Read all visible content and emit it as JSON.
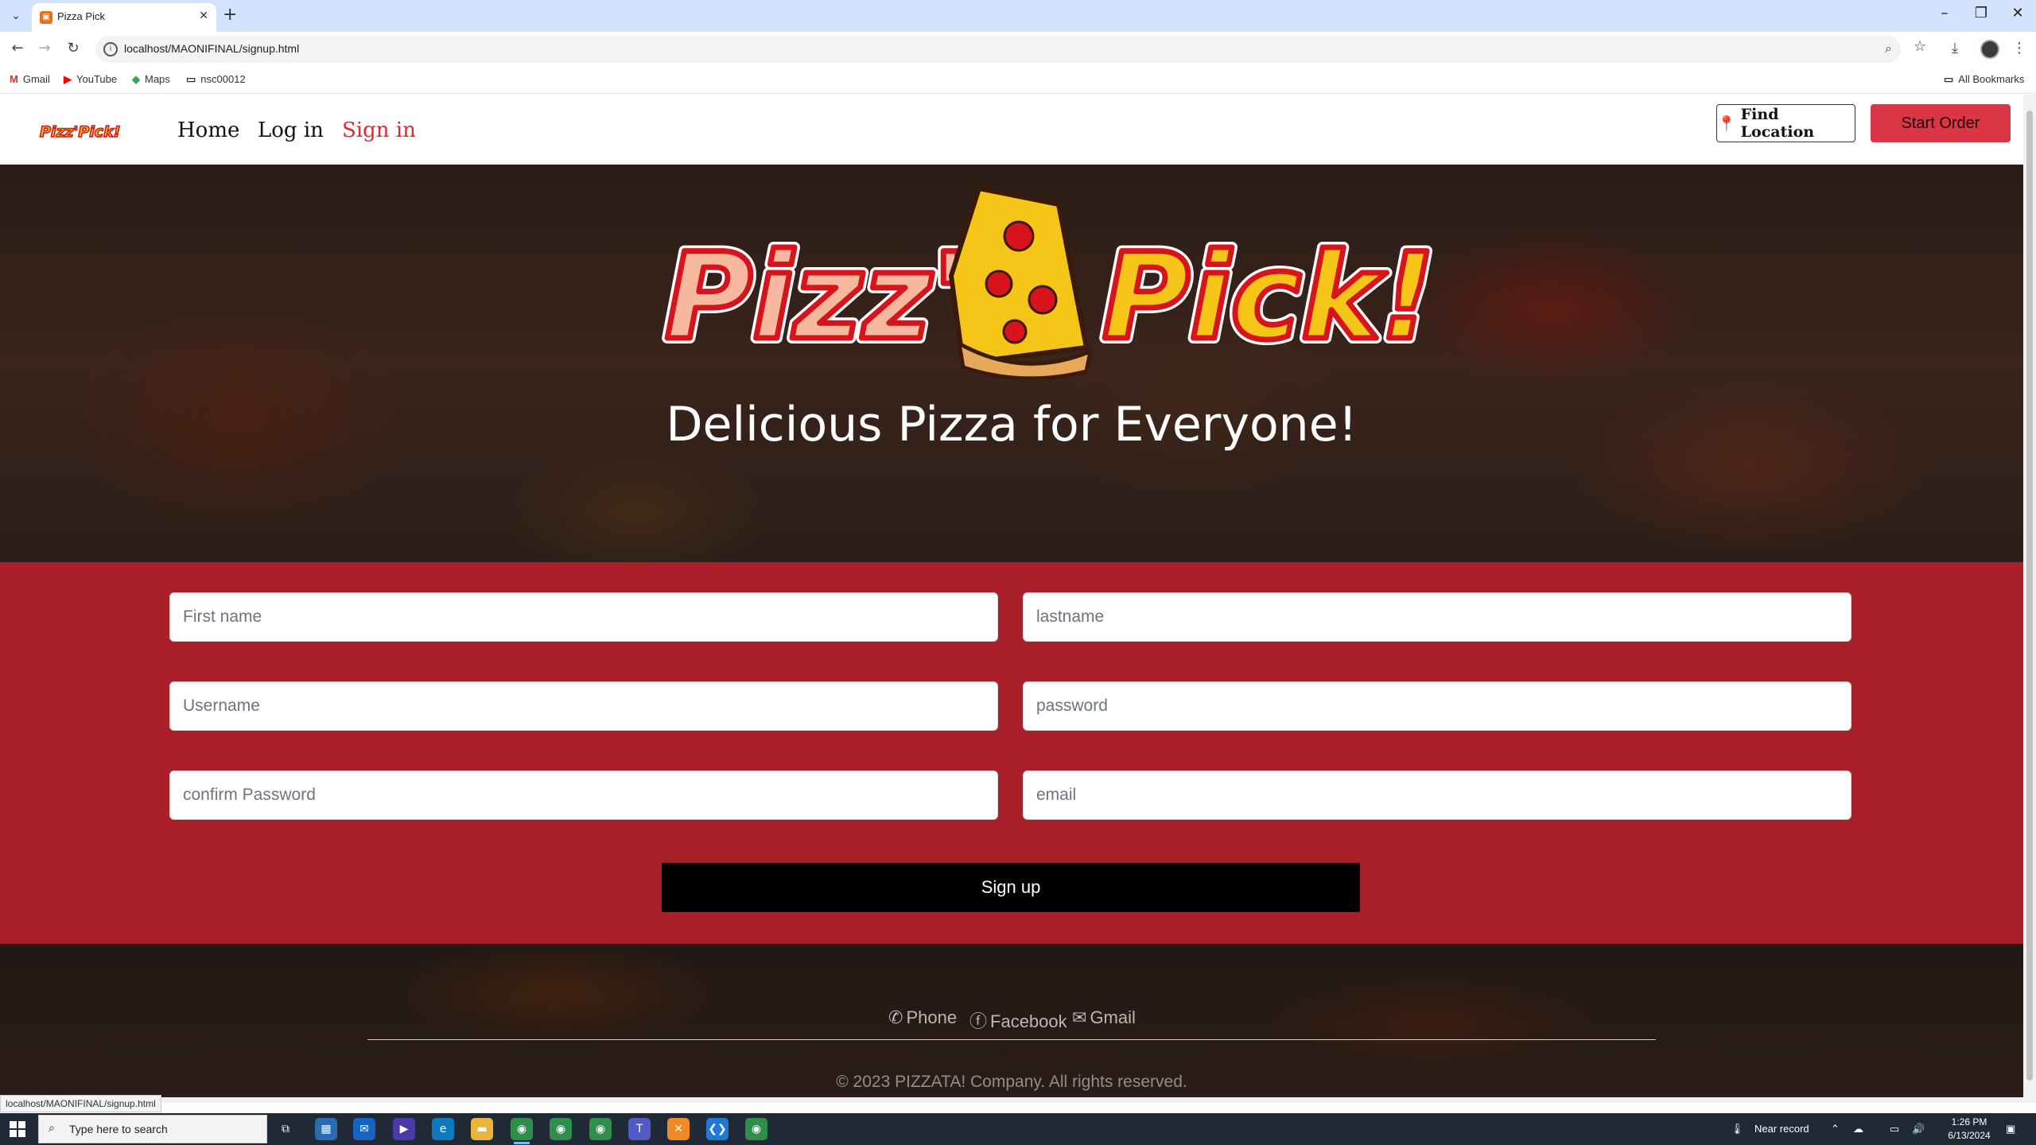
{
  "browser": {
    "tab_title": "Pizza Pick",
    "url": "localhost/MAONIFINAL/signup.html",
    "bookmarks": [
      {
        "label": "Gmail",
        "icon": "gmail-icon"
      },
      {
        "label": "YouTube",
        "icon": "youtube-icon"
      },
      {
        "label": "Maps",
        "icon": "maps-icon"
      },
      {
        "label": "nsc00012",
        "icon": "folder-icon"
      }
    ],
    "all_bookmarks": "All Bookmarks",
    "status_url": "localhost/MAONIFINAL/signup.html"
  },
  "navbar": {
    "brand_text": "Pizz'Pick!",
    "links": [
      "Home",
      "Log in",
      "Sign in"
    ],
    "active_link": "Sign in",
    "find_location": "Find Location",
    "start_order": "Start Order"
  },
  "hero": {
    "logo_left": "Pizz'",
    "logo_right": "Pick!",
    "tagline": "Delicious Pizza for Everyone!"
  },
  "form": {
    "first_name_placeholder": "First name",
    "last_name_placeholder": "lastname",
    "username_placeholder": "Username",
    "password_placeholder": "password",
    "confirm_password_placeholder": "confirm Password",
    "email_placeholder": "email",
    "submit_label": "Sign up"
  },
  "footer": {
    "phone": "Phone",
    "facebook": "Facebook",
    "gmail": "Gmail",
    "copyright": "© 2023 PIZZATA! Company.  All rights reserved."
  },
  "taskbar": {
    "search_placeholder": "Type here to search",
    "weather": "Near record",
    "time": "1:26 PM",
    "date": "6/13/2024"
  },
  "colors": {
    "accent_red": "#dc3545",
    "form_bg": "#a91f2a",
    "active_link": "#e3262b"
  }
}
